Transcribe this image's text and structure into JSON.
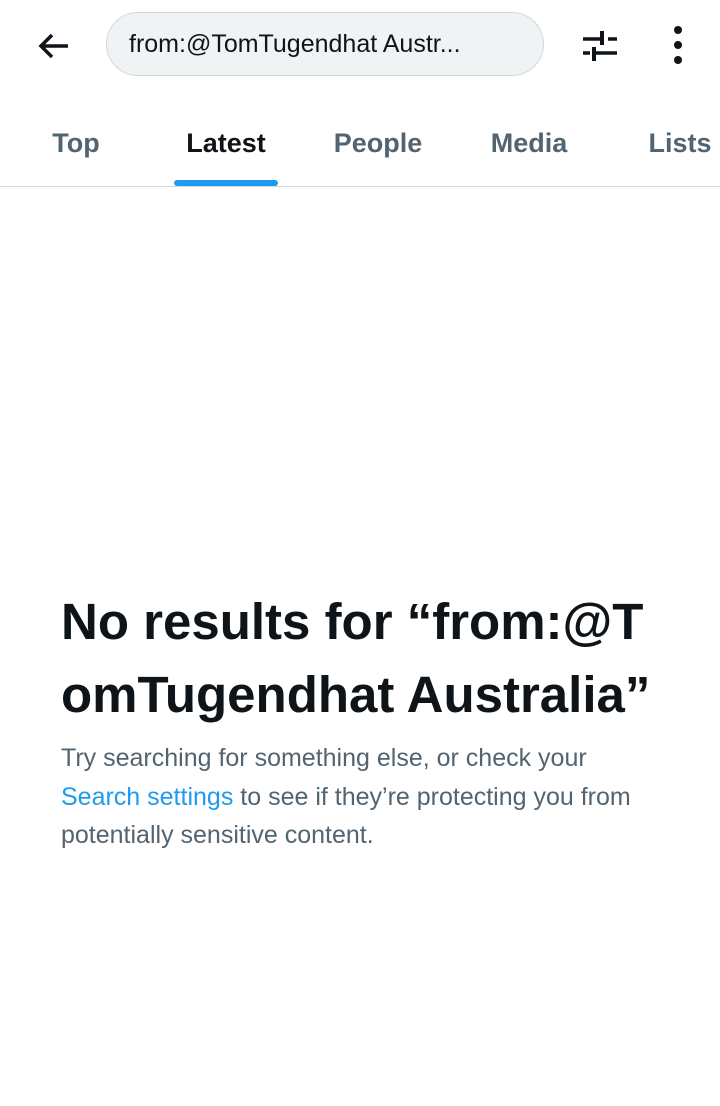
{
  "header": {
    "back_icon": "arrow-left-icon",
    "search_value": "from:@TomTugendhat Austr...",
    "filter_icon": "sliders-icon",
    "more_icon": "vertical-ellipsis-icon"
  },
  "tabs": [
    {
      "label": "Top",
      "active": false
    },
    {
      "label": "Latest",
      "active": true
    },
    {
      "label": "People",
      "active": false
    },
    {
      "label": "Media",
      "active": false
    },
    {
      "label": "Lists",
      "active": false
    }
  ],
  "empty_state": {
    "title": "No results for “from:@TomTugendhat Australia”",
    "text_before": "Try searching for something else, or check your ",
    "link": "Search settings",
    "text_after": " to see if they’re protecting you from potentially sensitive content."
  },
  "colors": {
    "accent": "#1d9bf0",
    "muted": "#536471",
    "text": "#0f1419"
  }
}
